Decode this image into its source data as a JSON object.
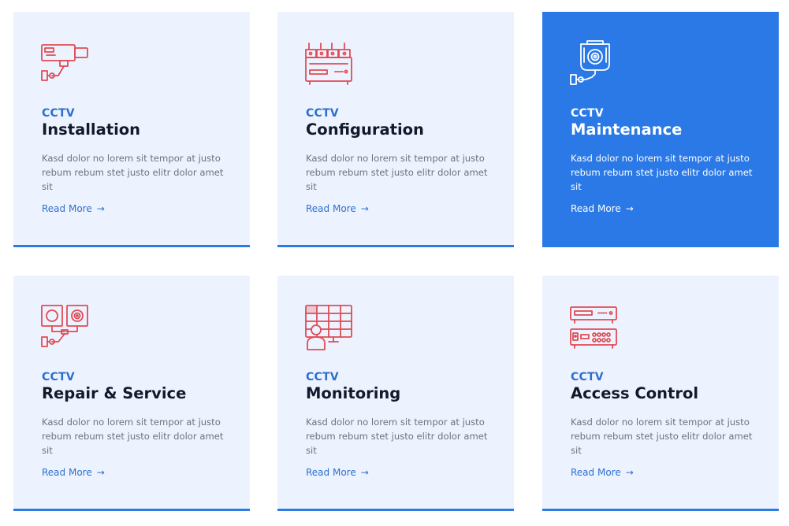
{
  "colors": {
    "card_bg": "#edf3fe",
    "active_bg": "#2a79e6",
    "accent": "#2d6fce",
    "icon_red": "#e04b55",
    "title": "#11192b",
    "text_muted": "#6b7280"
  },
  "cards": [
    {
      "icon": "cctv-camera-icon",
      "eyebrow": "CCTV",
      "title": "Installation",
      "description": "Kasd dolor no lorem sit tempor at justo rebum rebum stet justo elitr dolor amet sit",
      "link_label": "Read More",
      "link_icon": "arrow-right-icon",
      "active": false
    },
    {
      "icon": "dvr-recorder-icon",
      "eyebrow": "CCTV",
      "title": "Configuration",
      "description": "Kasd dolor no lorem sit tempor at justo rebum rebum stet justo elitr dolor amet sit",
      "link_label": "Read More",
      "link_icon": "arrow-right-icon",
      "active": false
    },
    {
      "icon": "dome-camera-icon",
      "eyebrow": "CCTV",
      "title": "Maintenance",
      "description": "Kasd dolor no lorem sit tempor at justo rebum rebum stet justo elitr dolor amet sit",
      "link_label": "Read More",
      "link_icon": "arrow-right-icon",
      "active": true
    },
    {
      "icon": "camera-pair-icon",
      "eyebrow": "CCTV",
      "title": "Repair & Service",
      "description": "Kasd dolor no lorem sit tempor at justo rebum rebum stet justo elitr dolor amet sit",
      "link_label": "Read More",
      "link_icon": "arrow-right-icon",
      "active": false
    },
    {
      "icon": "monitoring-screen-icon",
      "eyebrow": "CCTV",
      "title": "Monitoring",
      "description": "Kasd dolor no lorem sit tempor at justo rebum rebum stet justo elitr dolor amet sit",
      "link_label": "Read More",
      "link_icon": "arrow-right-icon",
      "active": false
    },
    {
      "icon": "access-control-unit-icon",
      "eyebrow": "CCTV",
      "title": "Access Control",
      "description": "Kasd dolor no lorem sit tempor at justo rebum rebum stet justo elitr dolor amet sit",
      "link_label": "Read More",
      "link_icon": "arrow-right-icon",
      "active": false
    }
  ]
}
